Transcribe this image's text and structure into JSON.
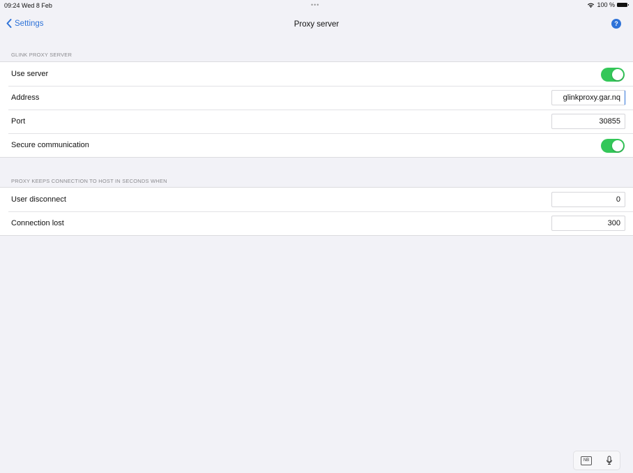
{
  "status_bar": {
    "time_date": "09:24  Wed 8 Feb",
    "dots": "•••",
    "battery": "100 %",
    "wifi_icon": "wifi-icon",
    "battery_icon": "battery-icon"
  },
  "nav": {
    "back_label": "Settings",
    "back_icon": "chevron-left-icon",
    "title": "Proxy server",
    "help_glyph": "?",
    "help_icon": "help-icon"
  },
  "section_proxy": {
    "header": "GLINK PROXY SERVER",
    "use_server_label": "Use server",
    "use_server_on": true,
    "address_label": "Address",
    "address_value": "glinkproxy.gar.nq",
    "port_label": "Port",
    "port_value": "30855",
    "secure_label": "Secure communication",
    "secure_on": true
  },
  "section_keep": {
    "header": "PROXY KEEPS CONNECTION TO HOST IN SECONDS WHEN",
    "user_disconnect_label": "User disconnect",
    "user_disconnect_value": "0",
    "connection_lost_label": "Connection lost",
    "connection_lost_value": "300"
  },
  "keyboard_bar": {
    "nb_label": "NB",
    "mic_icon": "microphone-icon"
  },
  "colors": {
    "accent": "#2f73d8",
    "toggle_on": "#34c759",
    "background": "#f2f2f7"
  }
}
